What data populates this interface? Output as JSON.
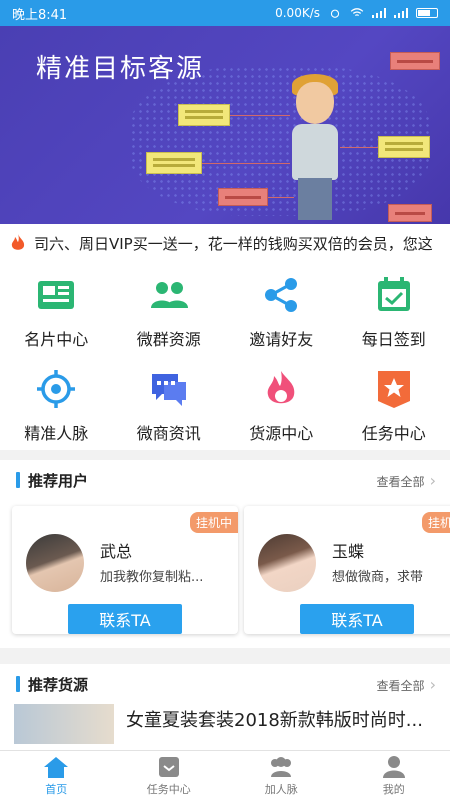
{
  "status_bar": {
    "time": "晚上8:41",
    "speed": "0.00K/s"
  },
  "banner": {
    "title": "精准目标客源"
  },
  "notice": {
    "text": "司六、周日VIP买一送一，花一样的钱购买双倍的会员，您这"
  },
  "grid": [
    {
      "label": "名片中心",
      "icon": "card-icon",
      "color": "#2bb673"
    },
    {
      "label": "微群资源",
      "icon": "group-icon",
      "color": "#2bb673"
    },
    {
      "label": "邀请好友",
      "icon": "share-icon",
      "color": "#2a9be8"
    },
    {
      "label": "每日签到",
      "icon": "calendar-check-icon",
      "color": "#2bb673"
    },
    {
      "label": "精准人脉",
      "icon": "target-icon",
      "color": "#2a9be8"
    },
    {
      "label": "微商资讯",
      "icon": "chat-icon",
      "color": "#3f63e0"
    },
    {
      "label": "货源中心",
      "icon": "flame-icon",
      "color": "#f0507a"
    },
    {
      "label": "任务中心",
      "icon": "star-badge-icon",
      "color": "#f26b3a"
    }
  ],
  "recommend_users": {
    "title": "推荐用户",
    "more": "查看全部",
    "cards": [
      {
        "badge": "挂机中",
        "name": "武总",
        "sign": "加我教你复制粘...",
        "button": "联系TA"
      },
      {
        "badge": "挂机中",
        "name": "玉蝶",
        "sign": "想做微商，求带",
        "button": "联系TA"
      }
    ]
  },
  "recommend_goods": {
    "title": "推荐货源",
    "more": "查看全部",
    "items": [
      {
        "title": "女童夏装套装2018新款韩版时尚时..."
      }
    ]
  },
  "tabbar": [
    {
      "label": "首页",
      "icon": "home-icon",
      "active": true
    },
    {
      "label": "任务中心",
      "icon": "task-icon",
      "active": false
    },
    {
      "label": "加人脉",
      "icon": "people-icon",
      "active": false
    },
    {
      "label": "我的",
      "icon": "profile-icon",
      "active": false
    }
  ]
}
